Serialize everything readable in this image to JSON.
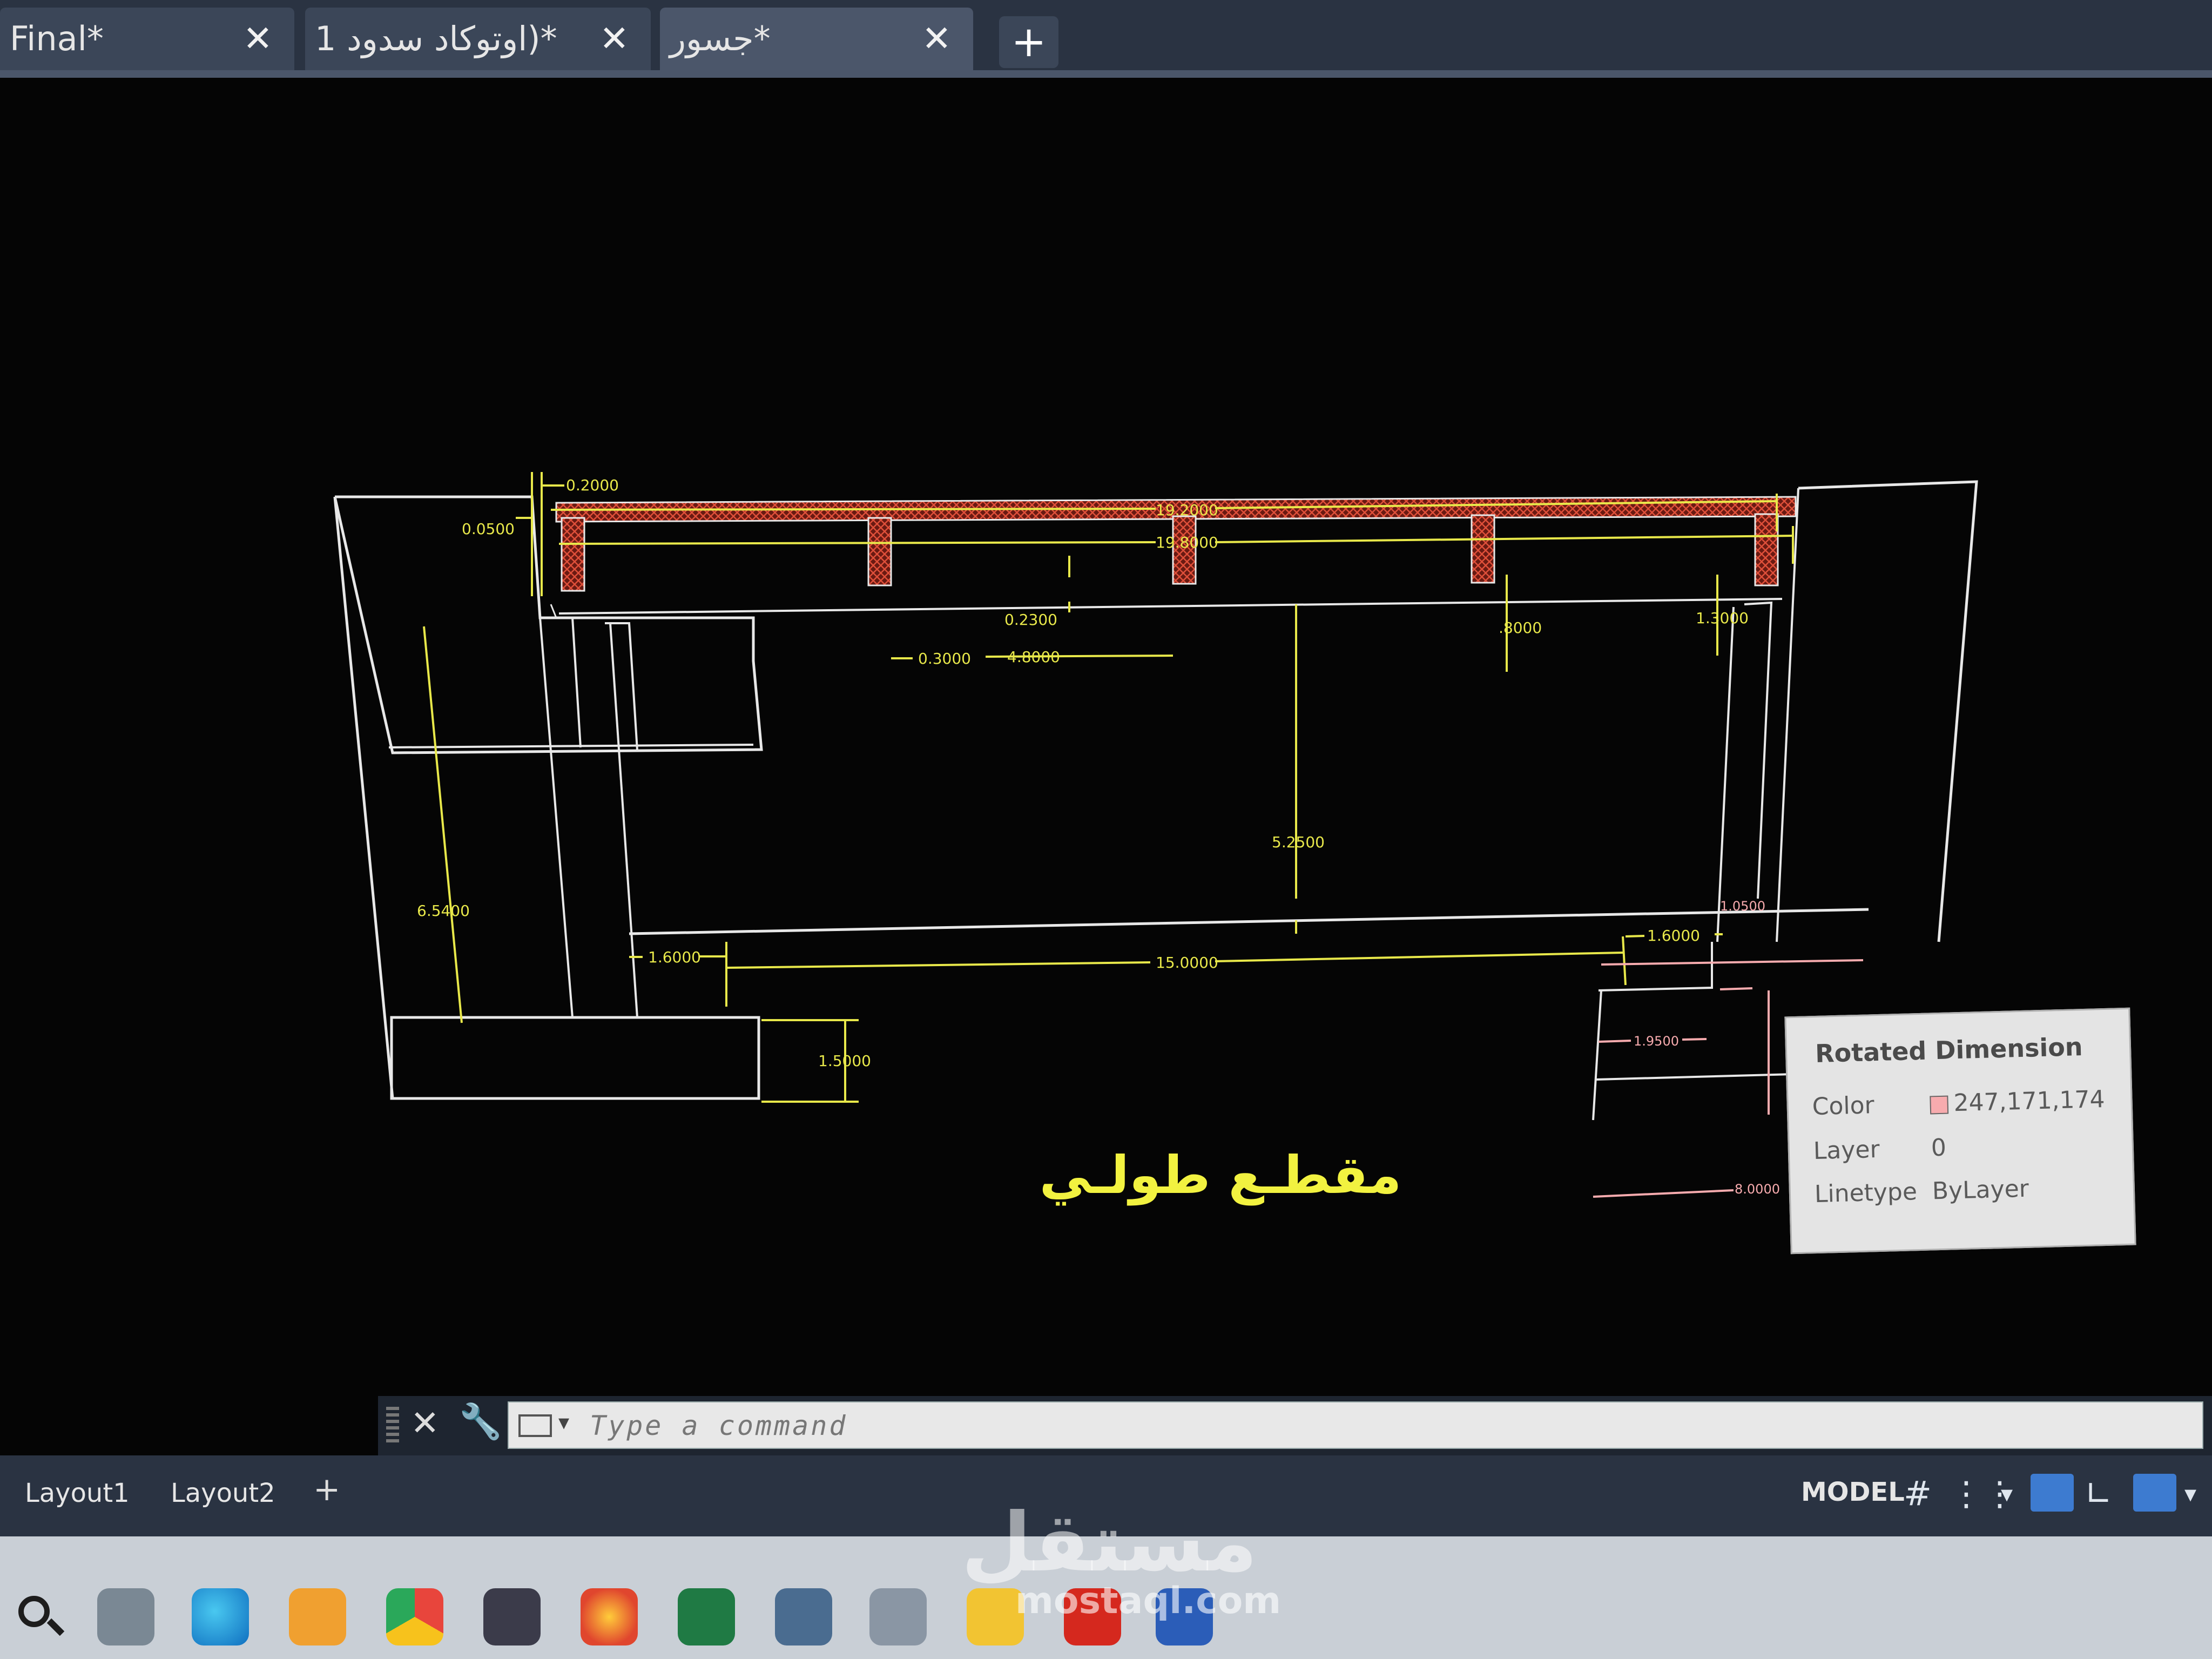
{
  "tabs": [
    {
      "label": "Final*"
    },
    {
      "label": "اوتوكاد سدود 1)*"
    },
    {
      "label": "جسور*"
    }
  ],
  "tab_add_symbol": "+",
  "tab_close_symbol": "✕",
  "drawing": {
    "title": "مقطـع طولـي",
    "dimensions": {
      "d_0_2": "0.2000",
      "d_0_05": "0.0500",
      "d_19_2": "19.2000",
      "d_19_8": "19.8000",
      "d_0_23": "0.2300",
      "d_0_3": "0.3000",
      "d_4_8": "4.8000",
      "d_0_8": ".8000",
      "d_1_3": "1.3000",
      "d_5_25": "5.2500",
      "d_6_54": "6.5400",
      "d_1_6_left": "1.6000",
      "d_15": "15.0000",
      "d_1_6_right": "1.6000",
      "d_1_05": "1.0500",
      "d_1_95": "1.9500",
      "d_1_5": "1.5000",
      "d_8": "8.0000"
    },
    "colors": {
      "outline": "#e8e8e8",
      "dimension_yellow": "#e8e84a",
      "dimension_red": "#f7abae",
      "hatch_red": "#c23a2a",
      "title_yellow": "#f2f240"
    }
  },
  "tooltip": {
    "title": "Rotated Dimension",
    "color_label": "Color",
    "color_value": "247,171,174",
    "layer_label": "Layer",
    "layer_value": "0",
    "linetype_label": "Linetype",
    "linetype_value": "ByLayer"
  },
  "command_line": {
    "placeholder": "Type a command",
    "close_symbol": "✕",
    "wrench_icon": "wrench-icon"
  },
  "layout_tabs": [
    {
      "label": "Layout1"
    },
    {
      "label": "Layout2"
    }
  ],
  "layout_add_symbol": "+",
  "status": {
    "model_label": "MODEL",
    "grid_icon": "grid-icon",
    "snap_icon": "snap-icon"
  },
  "taskbar_icons": [
    "search-icon",
    "task-view-icon",
    "edge-icon",
    "store-icon",
    "chrome-icon",
    "media-player-icon",
    "firefox-icon",
    "excel-icon",
    "calculator-icon",
    "3d-viewer-icon",
    "file-explorer-icon",
    "autocad-icon",
    "word-icon"
  ],
  "watermark": {
    "main": "مستقل",
    "sub": "mostaql.com"
  }
}
